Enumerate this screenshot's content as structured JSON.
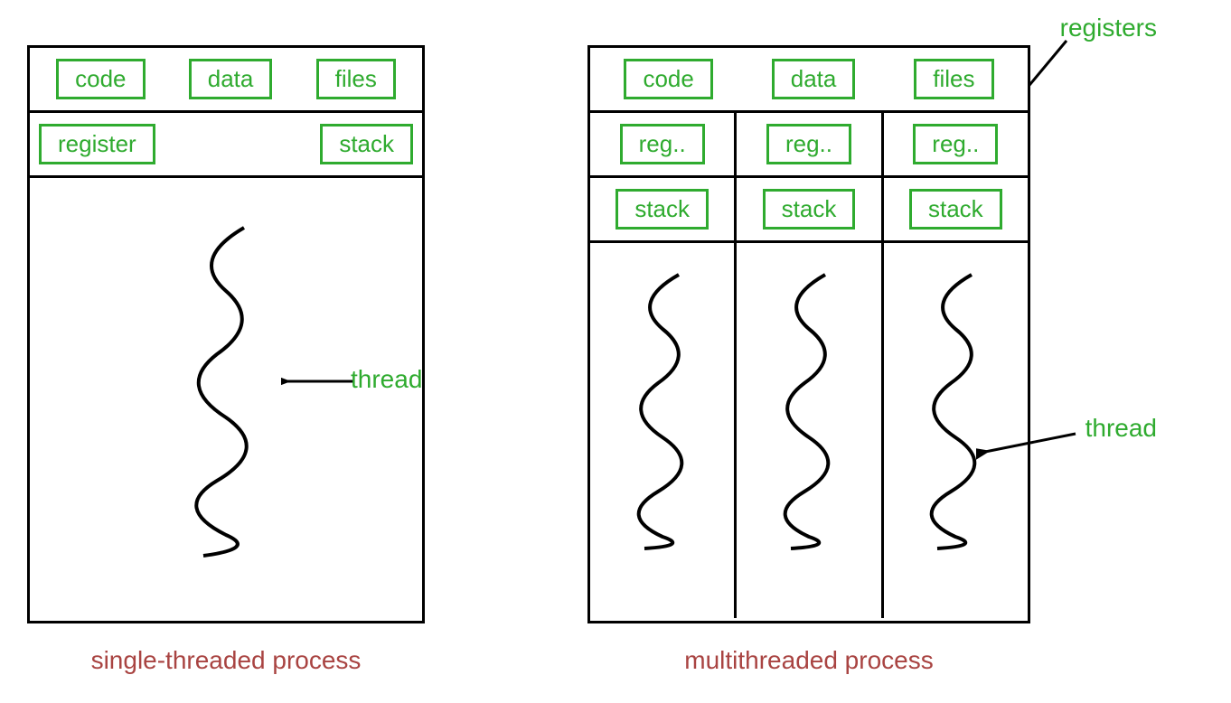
{
  "diagrams": {
    "single": {
      "header": [
        "code",
        "data",
        "files"
      ],
      "row2_left": "register",
      "row2_right": "stack",
      "thread_label": "thread",
      "caption": "single-threaded process"
    },
    "multi": {
      "header": [
        "code",
        "data",
        "files"
      ],
      "columns": [
        {
          "reg": "reg..",
          "stack": "stack"
        },
        {
          "reg": "reg..",
          "stack": "stack"
        },
        {
          "reg": "reg..",
          "stack": "stack"
        }
      ],
      "registers_label": "registers",
      "thread_label": "thread",
      "caption": "multithreaded process"
    }
  }
}
